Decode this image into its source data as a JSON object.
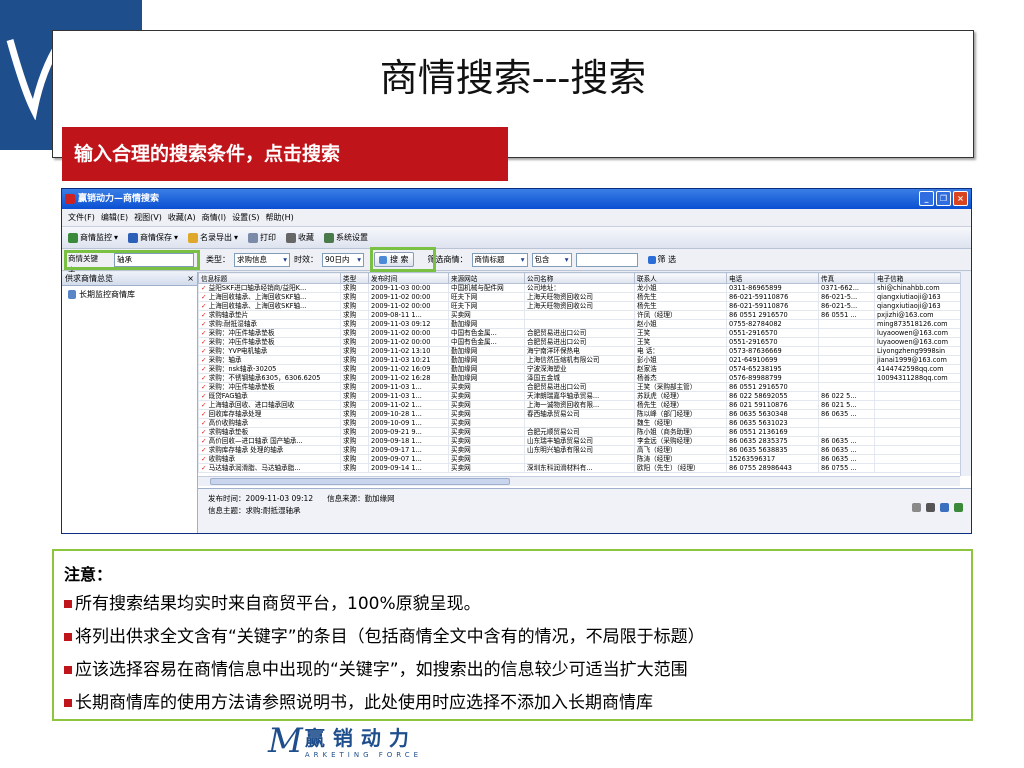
{
  "slide": {
    "title": "商情搜索---搜索",
    "banner": "输入合理的搜索条件，点击搜索"
  },
  "window": {
    "title": "赢销动力—商情搜索",
    "menu": [
      "文件(F)",
      "编辑(E)",
      "视图(V)",
      "收藏(A)",
      "商情(I)",
      "设置(S)",
      "帮助(H)"
    ],
    "toolbar": [
      "商情监控",
      "商情保存",
      "名录导出",
      "打印",
      "收藏",
      "系统设置"
    ],
    "search": {
      "keyword_label": "商情关键字：",
      "keyword_value": "轴承",
      "type_label": "类型：",
      "type_value": "求购信息",
      "period_label": "时效：",
      "period_value": "90日内",
      "search_button": "搜 索",
      "filter_label": "筛选商情：",
      "filter_field": "商情标题",
      "filter_op": "包含",
      "filter_value": "",
      "filter_button": "筛 选"
    },
    "left_panel": {
      "title": "供求商情总览",
      "close": "×",
      "items": [
        "长期监控商情库"
      ]
    },
    "table": {
      "columns": [
        "信息标题",
        "类型",
        "发布时间",
        "来源网站",
        "公司名称",
        "联系人",
        "电话",
        "传真",
        "电子信箱"
      ],
      "rows": [
        [
          "益阳SKF进口轴承经销商/益阳K...",
          "求购",
          "2009-11-03 00:00",
          "中国机械与配件网",
          "公司地址：",
          "龙小姐",
          "0311-86965899",
          "0371-662...",
          "shi@chinahbb.com"
        ],
        [
          "上海回收轴承、上海回收SKF轴...",
          "求购",
          "2009-11-02 00:00",
          "旺夫下网",
          "上海天旺物资回收公司",
          "杨先生",
          "86-021-59110876",
          "86-021-5...",
          "qiangxiutiaoji@163"
        ],
        [
          "上海回收轴承、上海回收SKF轴...",
          "求购",
          "2009-11-02 00:00",
          "旺夫下网",
          "上海天旺物资回收公司",
          "杨先生",
          "86-021-59110876",
          "86-021-5...",
          "qiangxiutiaoji@163"
        ],
        [
          "求购轴承垫片",
          "求购",
          "2009-08-11 1...",
          "买卖网",
          "",
          "许凤（经理）",
          "86 0551 2916570",
          "86 0551 ...",
          "pxjizhi@163.com"
        ],
        [
          "求购:耐抵湿轴承",
          "求购",
          "2009-11-03 09:12",
          "勤加缘网",
          "",
          "赵小姐",
          "0755-82784082",
          "",
          "ming873518126.com"
        ],
        [
          "采购：冲压件轴承垫板",
          "求购",
          "2009-11-02 00:00",
          "中国有色金属...",
          "合肥贸易进出口公司",
          "王笑",
          "0551-2916570",
          "",
          "luyaoowen@163.com"
        ],
        [
          "采购：冲压件轴承垫板",
          "求购",
          "2009-11-02 00:00",
          "中国有色金属...",
          "合肥贸易进出口公司",
          "王笑",
          "0551-2916570",
          "",
          "luyaoowen@163.com"
        ],
        [
          "采购：YVP电机轴承",
          "求购",
          "2009-11-02 13:10",
          "勤加缘网",
          "海宁南洋环保热电",
          "电  话：",
          "0573-87636669",
          "",
          "Liyongzheng9998sin"
        ],
        [
          "采购：轴承",
          "求购",
          "2009-11-03 10:21",
          "勤加缘网",
          "上海信然压缩机有限公司",
          "彭小姐",
          "021-64910699",
          "",
          "jianai1999@163.com"
        ],
        [
          "采购：nsk轴承-30205",
          "求购",
          "2009-11-02 16:09",
          "勤加缘网",
          "宁波深海塑业",
          "赵家浩",
          "0574-65238195",
          "",
          "4144742598qq.com"
        ],
        [
          "求购：不锈钢轴承6305，6306.6205",
          "求购",
          "2009-11-02 16:28",
          "勤加缘网",
          "泽国五金城",
          "杨善杰",
          "0576-89988799",
          "",
          "10094311288qq.com"
        ],
        [
          "采购：冲压件轴承垫板",
          "求购",
          "2009-11-03 1...",
          "买卖网",
          "合肥贸易进出口公司",
          "王笑（采购部主管）",
          "86 0551 2916570",
          "",
          ""
        ],
        [
          "既贷FAG轴承",
          "求购",
          "2009-11-03 1...",
          "买卖网",
          "天津朗瑞嘉华轴承贸易...",
          "苏跃虎（经理）",
          "86 022 58692055",
          "86 022 5...",
          ""
        ],
        [
          "上海轴承回收、进口轴承回收",
          "求购",
          "2009-11-02 1...",
          "买卖网",
          "上海一诚物资回收有限...",
          "杨先生（经理）",
          "86 021 59110876",
          "86 021 5...",
          ""
        ],
        [
          "回收库存轴承处理",
          "求购",
          "2009-10-28 1...",
          "买卖网",
          "春西轴承贸易公司",
          "陈以峰（部门经理）",
          "86 0635 5630348",
          "86 0635 ...",
          ""
        ],
        [
          "高价收购轴承",
          "求购",
          "2009-10-09 1...",
          "买卖网",
          "",
          "魏生（经理）",
          "86 0635 5631023",
          "",
          ""
        ],
        [
          "求购轴承垫板",
          "求购",
          "2009-09-21 9...",
          "买卖网",
          "合肥元顺贸易公司",
          "陈小姐（商务助理）",
          "86 0551 2136169",
          "",
          ""
        ],
        [
          "高价回收—进口轴承 国产轴承...",
          "求购",
          "2009-09-18 1...",
          "买卖网",
          "山东瑞丰轴承贸易公司",
          "李金远（采购经理）",
          "86 0635 2835375",
          "86 0635 ...",
          ""
        ],
        [
          "求购库存轴承 处理的轴承",
          "求购",
          "2009-09-17 1...",
          "买卖网",
          "山东明兴轴承有限公司",
          "高飞（经理）",
          "86 0635 5638835",
          "86 0635 ...",
          ""
        ],
        [
          "收购轴承",
          "求购",
          "2009-09-07 1...",
          "买卖网",
          "",
          "陈涛（经理）",
          "15263596317",
          "86 0635 ...",
          ""
        ],
        [
          "马达轴承润滑脂、马达轴承脂...",
          "求购",
          "2009-09-14 1...",
          "买卖网",
          "深圳东科润滑材料有...",
          "欧阳（先生）（经理）",
          "86 0755 28986443",
          "86 0755 ...",
          ""
        ]
      ]
    },
    "detail": {
      "time_label": "发布时间：",
      "time_value": "2009-11-03 09:12",
      "source_label": "信息来源：",
      "source_value": "勤加缘网",
      "subject_label": "信息主题：",
      "subject_value": "求购:耐抵湿轴承"
    }
  },
  "notes": {
    "title": "注意：",
    "lines": [
      "所有搜索结果均实时来自商贸平台，100%原貌呈现。",
      "将列出供求全文含有“关键字”的条目（包括商情全文中含有的情况，不局限于标题）",
      "应该选择容易在商情信息中出现的“关键字”，如搜索出的信息较少可适当扩大范围",
      "长期商情库的使用方法请参照说明书，此处使用时应选择不添加入长期商情库"
    ]
  },
  "footer": {
    "logo_mark": "M",
    "logo_cn": "赢销动力",
    "logo_en": "ARKETING FORCE"
  },
  "colors": {
    "brand_blue": "#1f4e8c",
    "banner_red": "#c0141b",
    "highlight_green": "#7ac143",
    "check_red": "#dd2222"
  }
}
